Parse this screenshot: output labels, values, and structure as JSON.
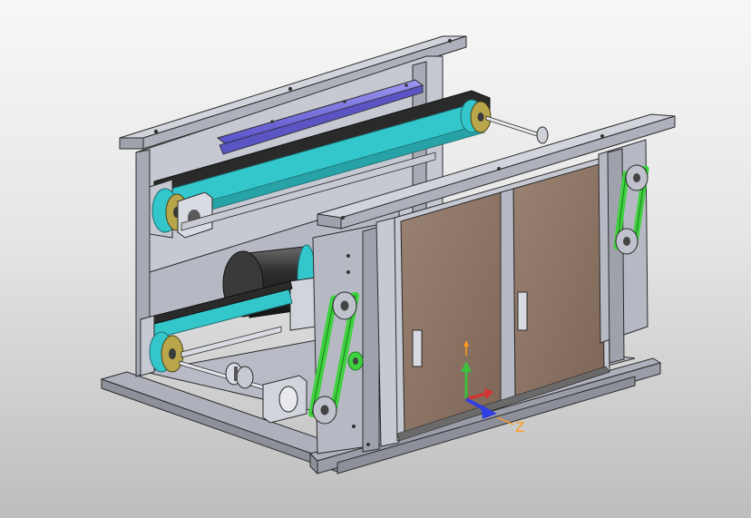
{
  "scene": {
    "background_top": "#f7f7f7",
    "background_bottom": "#bdbdbd",
    "frame_color": "#bfc2cc",
    "belt_cyan": "#33c7cc",
    "belt_green": "#3fd23f",
    "rail_purple": "#6a63d8",
    "pulley_gold": "#b9a64a",
    "panel_brown": "#8e7565",
    "motor_dark": "#2e2e2e"
  },
  "triad": {
    "z_label": "Z",
    "x_color": "#d93030",
    "y_color": "#3cbf3c",
    "z_color": "#3040e0",
    "label_color": "#ff9a1a"
  }
}
